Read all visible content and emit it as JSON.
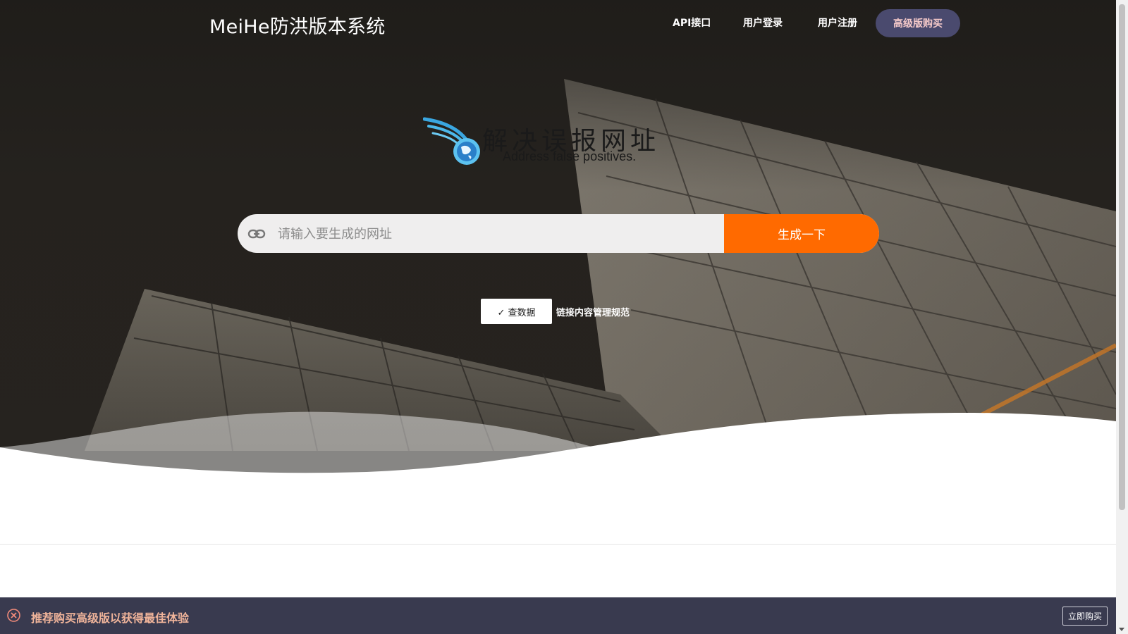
{
  "header": {
    "brand": "MeiHe防洪版本系统",
    "nav": {
      "api": "API接口",
      "login": "用户登录",
      "register": "用户注册",
      "premium": "高级版购买"
    }
  },
  "logo": {
    "title": "解决误报网址",
    "subtitle": "Address false positives."
  },
  "search": {
    "placeholder": "请输入要生成的网址",
    "value": "",
    "button": "生成一下",
    "link_icon": "link-icon"
  },
  "actions": {
    "check_button": "✓ 查数据",
    "policy_link": "链接内容管理规范"
  },
  "banner": {
    "text": "推荐购买高级版以获得最佳体验",
    "button": "立即购买",
    "close_icon": "close-circle-icon"
  },
  "colors": {
    "accent": "#ff6a00",
    "premium_button": "#4a4a6e",
    "banner_bg": "#393a4f",
    "banner_text": "#f0b49a"
  }
}
